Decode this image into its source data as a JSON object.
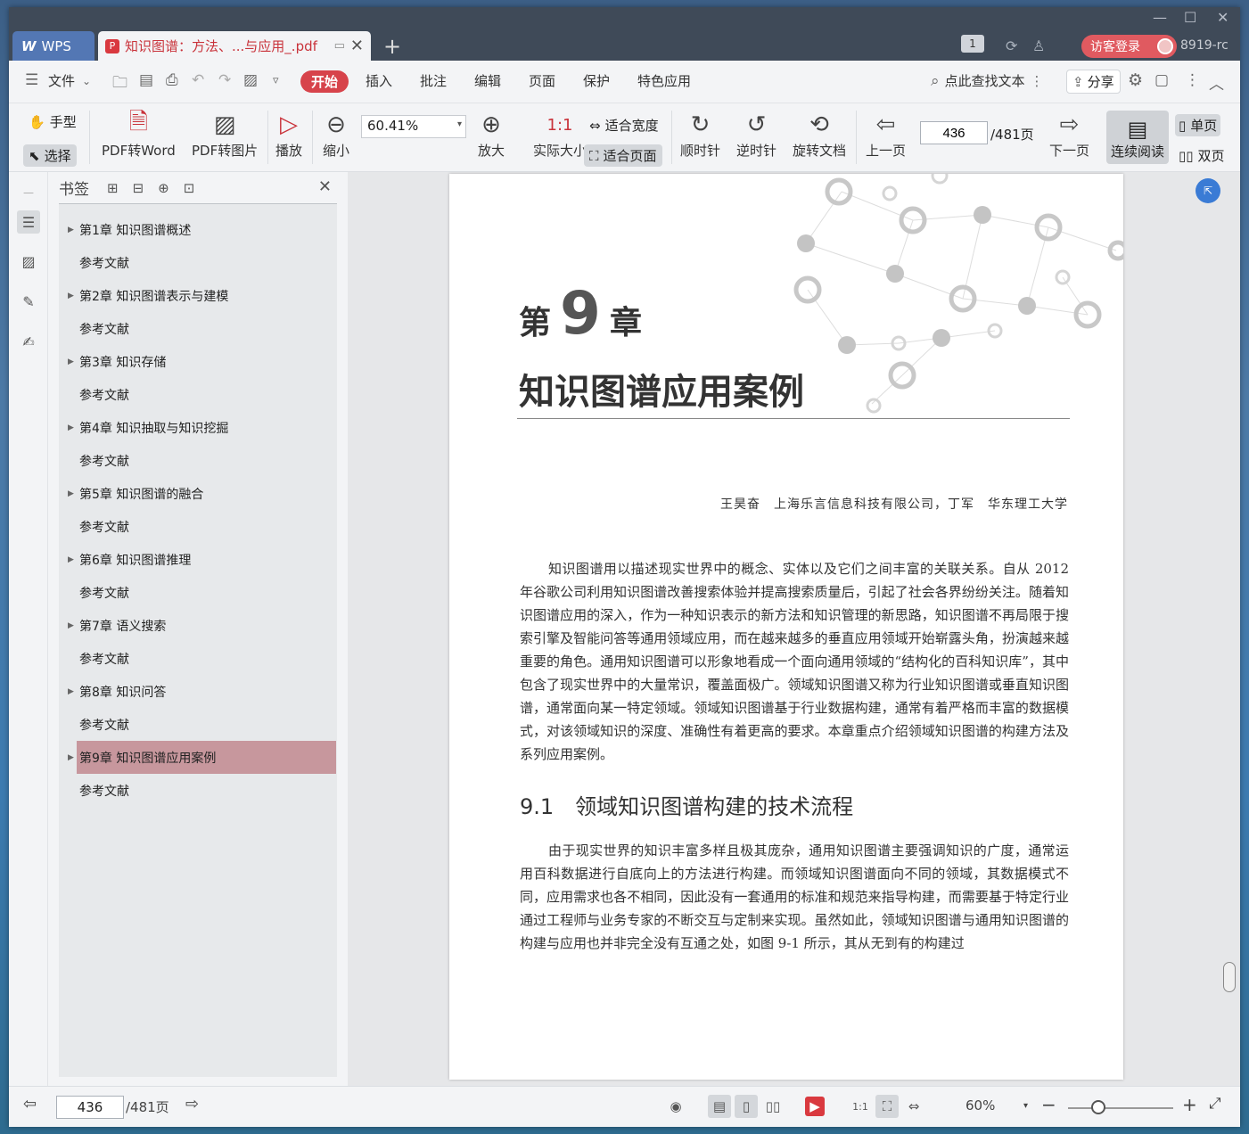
{
  "titlebar": {
    "app_name": "WPS",
    "doc_tab_title": "知识图谱：方法、...与应用_.pdf",
    "page_badge": "1",
    "guest_login": "访客登录",
    "version": "8919-rc",
    "new_tab": "+"
  },
  "menubar": {
    "file": "文件",
    "start": "开始",
    "insert": "插入",
    "annotate": "批注",
    "edit": "编辑",
    "page": "页面",
    "protect": "保护",
    "special": "特色应用",
    "search": "点此查找文本",
    "share": "分享"
  },
  "toolbar": {
    "hand": "手型",
    "select": "选择",
    "pdf_to_word": "PDF转Word",
    "pdf_to_image": "PDF转图片",
    "play": "播放",
    "zoom_out": "缩小",
    "zoom_value": "60.41%",
    "zoom_in": "放大",
    "actual_size": "实际大小",
    "fit_width": "适合宽度",
    "fit_page": "适合页面",
    "clockwise": "顺时针",
    "counterclockwise": "逆时针",
    "rotate_doc": "旋转文档",
    "prev_page": "上一页",
    "current_page": "436",
    "total_pages": "/481页",
    "next_page": "下一页",
    "continuous": "连续阅读",
    "single": "单页",
    "double": "双页"
  },
  "bookmarks": {
    "title": "书签",
    "items": [
      {
        "label": "第1章 知识图谱概述",
        "has_children": true
      },
      {
        "label": "参考文献",
        "has_children": false
      },
      {
        "label": "第2章 知识图谱表示与建模",
        "has_children": true
      },
      {
        "label": "参考文献",
        "has_children": false
      },
      {
        "label": "第3章 知识存储",
        "has_children": true
      },
      {
        "label": "参考文献",
        "has_children": false
      },
      {
        "label": "第4章 知识抽取与知识挖掘",
        "has_children": true
      },
      {
        "label": "参考文献",
        "has_children": false
      },
      {
        "label": "第5章 知识图谱的融合",
        "has_children": true
      },
      {
        "label": "参考文献",
        "has_children": false
      },
      {
        "label": "第6章 知识图谱推理",
        "has_children": true
      },
      {
        "label": "参考文献",
        "has_children": false
      },
      {
        "label": "第7章 语义搜索",
        "has_children": true
      },
      {
        "label": "参考文献",
        "has_children": false
      },
      {
        "label": "第8章 知识问答",
        "has_children": true
      },
      {
        "label": "参考文献",
        "has_children": false
      },
      {
        "label": "第9章 知识图谱应用案例",
        "has_children": true,
        "selected": true
      },
      {
        "label": "参考文献",
        "has_children": false
      }
    ]
  },
  "page": {
    "chapter_word1": "第",
    "chapter_num": "9",
    "chapter_word2": "章",
    "chapter_title": "知识图谱应用案例",
    "authors": "王昊奋　上海乐言信息科技有限公司，丁军　华东理工大学",
    "para1": "知识图谱用以描述现实世界中的概念、实体以及它们之间丰富的关联关系。自从 2012 年谷歌公司利用知识图谱改善搜索体验并提高搜索质量后，引起了社会各界纷纷关注。随着知识图谱应用的深入，作为一种知识表示的新方法和知识管理的新思路，知识图谱不再局限于搜索引擎及智能问答等通用领域应用，而在越来越多的垂直应用领域开始崭露头角，扮演越来越重要的角色。通用知识图谱可以形象地看成一个面向通用领域的“结构化的百科知识库”，其中包含了现实世界中的大量常识，覆盖面极广。领域知识图谱又称为行业知识图谱或垂直知识图谱，通常面向某一特定领域。领域知识图谱基于行业数据构建，通常有着严格而丰富的数据模式，对该领域知识的深度、准确性有着更高的要求。本章重点介绍领域知识图谱的构建方法及系列应用案例。",
    "section_title": "9.1　领域知识图谱构建的技术流程",
    "para2": "由于现实世界的知识丰富多样且极其庞杂，通用知识图谱主要强调知识的广度，通常运用百科数据进行自底向上的方法进行构建。而领域知识图谱面向不同的领域，其数据模式不同，应用需求也各不相同，因此没有一套通用的标准和规范来指导构建，而需要基于特定行业通过工程师与业务专家的不断交互与定制来实现。虽然如此，领域知识图谱与通用知识图谱的构建与应用也并非完全没有互通之处，如图 9-1 所示，其从无到有的构建过"
  },
  "statusbar": {
    "current_page": "436",
    "total_pages": "/481页",
    "zoom": "60%"
  }
}
